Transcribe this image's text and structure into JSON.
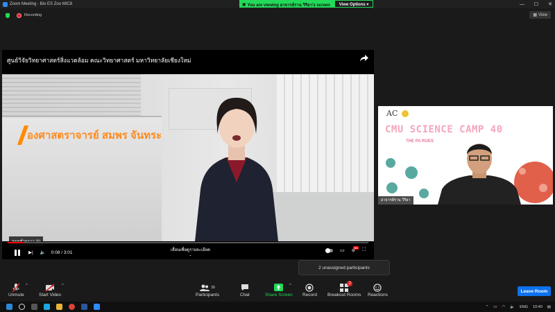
{
  "titlebar": {
    "title": "Zoom Meeting - Bio ES Zoo MIC8",
    "viewing_banner": "You are viewing อาจารย์ราน วิริยา's screen",
    "view_options": "View Options",
    "min": "—",
    "max": "☐",
    "close": "✕"
  },
  "status": {
    "recording": "Recording",
    "view_label": "View"
  },
  "shared_video": {
    "title": "ศูนย์วิจัยวิทยาศาสตร์สิ่งแวดล้อม คณะวิทยาศาสตร์ มหาวิทยาลัยเชียงใหม่",
    "caption": "องศาสตราจารย์ สมพร จันทระ",
    "pause_tooltip": "หยุดชั่วคราว (k)",
    "time": "0:08 / 3:01",
    "progress": 0.044,
    "seek_tip": "เลื่อนเพื่อดูรายละเอียด"
  },
  "participant": {
    "logo_text": "AC",
    "camp_title": "CMU SCIENCE CAMP 40",
    "camp_sub": "THE PA        ROES",
    "name": "อาจารย์ราน วิริยา"
  },
  "popup": {
    "text": "2 unassigned participants"
  },
  "toolbar": {
    "unmute": "Unmute",
    "start_video": "Start Video",
    "participants": "Participants",
    "participants_count": "39",
    "chat": "Chat",
    "share_screen": "Share Screen",
    "record": "Record",
    "breakout_rooms": "Breakout Rooms",
    "breakout_badge": "2",
    "reactions": "Reactions",
    "leave": "Leave Room"
  },
  "taskbar": {
    "lang": "ENG",
    "clock": "10:40"
  },
  "colors": {
    "share_green": "#23d959",
    "leave_blue": "#0e72ed",
    "recording_red": "#e02828",
    "caption_orange": "#ff8a1a"
  }
}
